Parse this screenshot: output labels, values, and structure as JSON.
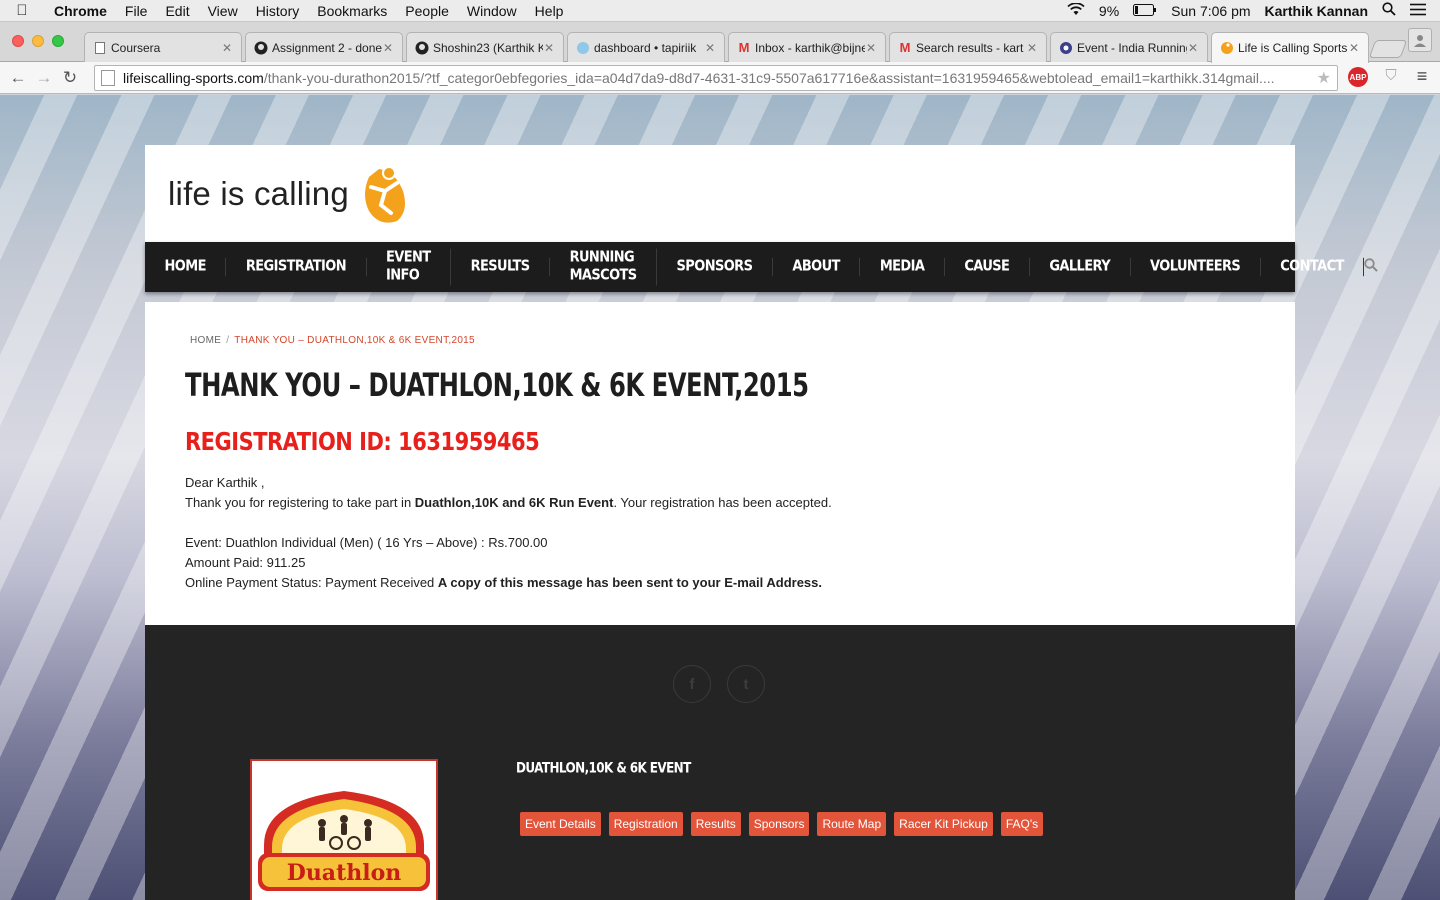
{
  "menubar": {
    "apple": "",
    "app": "Chrome",
    "items": [
      "File",
      "Edit",
      "View",
      "History",
      "Bookmarks",
      "People",
      "Window",
      "Help"
    ],
    "battery": "9%",
    "time": "Sun 7:06 pm",
    "user": "Karthik Kannan"
  },
  "tabs": [
    {
      "title": "Coursera",
      "icon": "page-icon"
    },
    {
      "title": "Assignment 2 - done",
      "icon": "github-icon"
    },
    {
      "title": "Shoshin23 (Karthik K",
      "icon": "github-icon"
    },
    {
      "title": "dashboard • tapiriik",
      "icon": "tapiriik-icon"
    },
    {
      "title": "Inbox - karthik@bijne",
      "icon": "gmail-icon"
    },
    {
      "title": "Search results - kart",
      "icon": "gmail-icon"
    },
    {
      "title": "Event - India Running",
      "icon": "event-icon"
    },
    {
      "title": "Life is Calling Sports",
      "icon": "lic-icon"
    }
  ],
  "toolbar": {
    "url_host": "lifeiscalling-sports.com",
    "url_path": "/thank-you-durathon2015/?tf_categor0ebfegories_ida=a04d7da9-d8d7-4631-31c9-5507a617716e&assistant=1631959465&webtolead_email1=karthikk.314gmail...."
  },
  "site": {
    "logo_text": "life is calling",
    "nav": [
      "HOME",
      "REGISTRATION",
      "EVENT INFO",
      "RESULTS",
      "RUNNING MASCOTS",
      "SPONSORS",
      "ABOUT",
      "MEDIA",
      "CAUSE",
      "GALLERY",
      "VOLUNTEERS",
      "CONTACT"
    ]
  },
  "breadcrumb": {
    "home": "HOME",
    "separator": "/",
    "current": "THANK YOU – DUATHLON,10K & 6K EVENT,2015"
  },
  "page": {
    "title": "THANK YOU – DUATHLON,10K & 6K EVENT,2015",
    "registration_id": "REGISTRATION ID: 1631959465",
    "greeting": "Dear Karthik ,",
    "thanks_pre": "Thank you for registering to take part in ",
    "thanks_event": "Duathlon,10K and 6K Run Event",
    "thanks_post": ". Your registration has been accepted.",
    "event_line": "Event: Duathlon Individual (Men) ( 16 Yrs – Above) : Rs.700.00",
    "amount_line": "Amount Paid: 911.25",
    "payment_pre": "Online Payment Status: Payment Received ",
    "payment_bold": "A copy of this message has been sent to your E-mail Address."
  },
  "footer": {
    "social": [
      "f",
      "t"
    ],
    "title": "DUATHLON,10K & 6K EVENT",
    "logo_text": "Duathlon",
    "links": [
      "Event Details",
      "Registration",
      "Results",
      "Sponsors",
      "Route Map",
      "Racer Kit Pickup",
      "FAQ's"
    ]
  },
  "colors": {
    "accent_red": "#e8201c",
    "breadcrumb_red": "#d6452b",
    "footer_button": "#e3553a",
    "nav_bg": "#1c1c1c",
    "logo_orange": "#f4a21c"
  }
}
